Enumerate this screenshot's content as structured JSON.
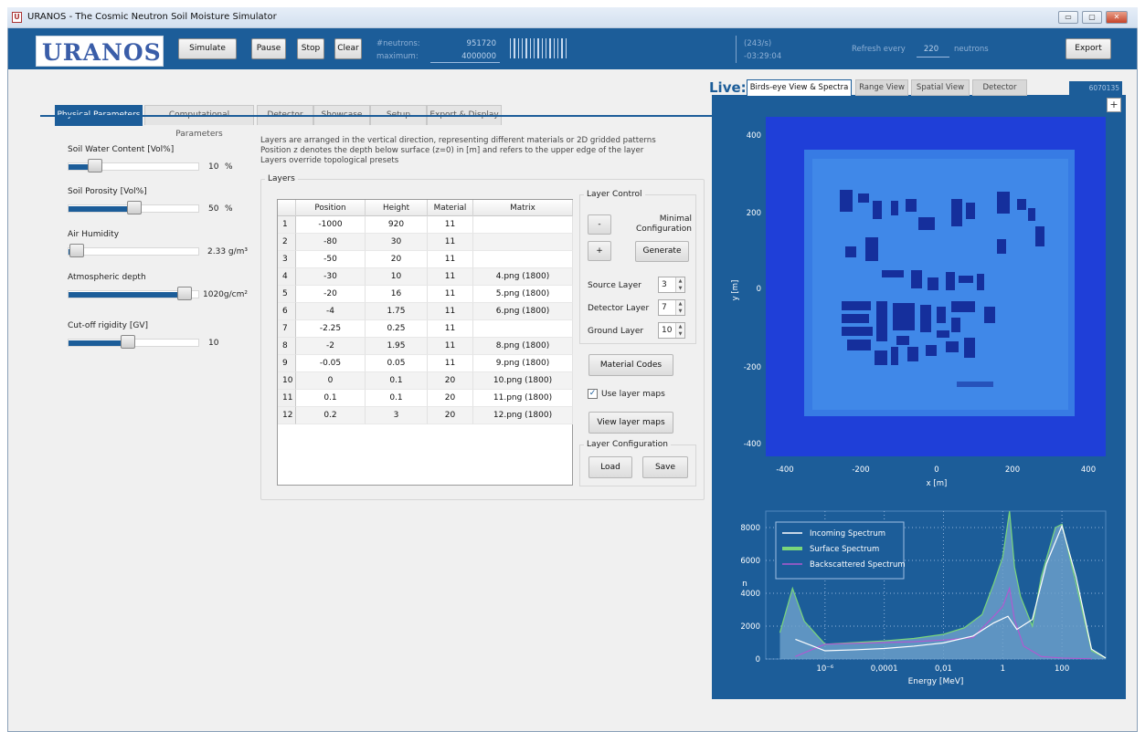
{
  "window": {
    "title": "URANOS - The Cosmic Neutron Soil Moisture Simulator",
    "icon": "uranos-icon",
    "min": "▭",
    "max": "▢",
    "close": "✕"
  },
  "toolbar": {
    "logo": "URANOS",
    "simulate": "Simulate",
    "pause": "Pause",
    "stop": "Stop",
    "clear": "Clear",
    "neutrons_label": "#neutrons:",
    "neutrons_value": "951720",
    "maximum_label": "maximum:",
    "maximum_value": "4000000",
    "rate": "(243/s)",
    "remaining": "-03:29:04",
    "refresh_label": "Refresh every",
    "refresh_value": "220",
    "refresh_unit": "neutrons",
    "export": "Export"
  },
  "tabs": [
    "Physical Parameters",
    "Computational Parameters",
    "Detector",
    "Showcase",
    "Setup",
    "Export & Display"
  ],
  "active_tab": 0,
  "params": [
    {
      "label": "Soil Water Content [Vol%]",
      "value": "10",
      "unit": "%",
      "level": 0.2
    },
    {
      "label": "Soil Porosity [Vol%]",
      "value": "50",
      "unit": "%",
      "level": 0.5
    },
    {
      "label": "Air Humidity",
      "value": "2.33 g/m³",
      "unit": "",
      "level": 0.06
    },
    {
      "label": "Atmospheric depth",
      "value": "1020g/cm²",
      "unit": "",
      "level": 0.88
    },
    {
      "label": "Cut-off rigidity [GV]",
      "value": "10",
      "unit": "",
      "level": 0.45
    }
  ],
  "info": [
    "Layers are arranged in the vertical direction, representing different materials or 2D gridded patterns",
    "Position z denotes the depth below surface (z=0) in [m] and refers to the upper edge of the layer",
    "Layers override topological presets"
  ],
  "layers": {
    "title": "Layers",
    "columns": [
      "Position",
      "Height",
      "Material",
      "Matrix"
    ],
    "rows": [
      [
        "1",
        "-1000",
        "920",
        "11",
        ""
      ],
      [
        "2",
        "-80",
        "30",
        "11",
        ""
      ],
      [
        "3",
        "-50",
        "20",
        "11",
        ""
      ],
      [
        "4",
        "-30",
        "10",
        "11",
        "4.png (1800)"
      ],
      [
        "5",
        "-20",
        "16",
        "11",
        "5.png (1800)"
      ],
      [
        "6",
        "-4",
        "1.75",
        "11",
        "6.png (1800)"
      ],
      [
        "7",
        "-2.25",
        "0.25",
        "11",
        ""
      ],
      [
        "8",
        "-2",
        "1.95",
        "11",
        "8.png (1800)"
      ],
      [
        "9",
        "-0.05",
        "0.05",
        "11",
        "9.png (1800)"
      ],
      [
        "10",
        "0",
        "0.1",
        "20",
        "10.png (1800)"
      ],
      [
        "11",
        "0.1",
        "0.1",
        "20",
        "11.png (1800)"
      ],
      [
        "12",
        "0.2",
        "3",
        "20",
        "12.png (1800)"
      ]
    ]
  },
  "control": {
    "title": "Layer Control",
    "minus": "-",
    "plus": "+",
    "minimal_line1": "Minimal",
    "minimal_line2": "Configuration",
    "generate": "Generate",
    "source_label": "Source Layer",
    "source_value": "3",
    "detector_label": "Detector Layer",
    "detector_value": "7",
    "ground_label": "Ground Layer",
    "ground_value": "10",
    "material_codes": "Material Codes",
    "use_maps": "Use layer maps",
    "use_maps_checked": true,
    "view_maps": "View layer maps",
    "config_title": "Layer Configuration",
    "load": "Load",
    "save": "Save"
  },
  "live": {
    "label": "Live:",
    "tabs": [
      "Birds-eye View & Spectra",
      "Range View",
      "Spatial View",
      "Detector"
    ],
    "active_tab": 0,
    "counter": "6070135",
    "plus": "+"
  },
  "map": {
    "x_label": "x [m]",
    "y_label": "y [m]",
    "x_ticks": [
      "-400",
      "-200",
      "0",
      "200",
      "400"
    ],
    "y_ticks": [
      "400",
      "200",
      "0",
      "-200",
      "-400"
    ],
    "colors": {
      "background": "#1f3fd8",
      "field": "#3c86e6",
      "buildings": "#152f9c"
    }
  },
  "chart_data": {
    "type": "line",
    "xlabel": "Energy [MeV]",
    "ylabel": "n",
    "x_scale": "log",
    "x_ticks": [
      "10⁻⁶",
      "0,0001",
      "0,01",
      "1",
      "100"
    ],
    "y_ticks": [
      "8000",
      "6000",
      "4000",
      "2000",
      "0"
    ],
    "ylim": [
      0,
      9000
    ],
    "legend_position": "top-left",
    "series": [
      {
        "name": "Incoming Spectrum",
        "color": "#ffffff",
        "points": [
          [
            1e-07,
            1200
          ],
          [
            1e-06,
            500
          ],
          [
            1e-05,
            560
          ],
          [
            0.0001,
            640
          ],
          [
            0.001,
            780
          ],
          [
            0.01,
            980
          ],
          [
            0.1,
            1400
          ],
          [
            0.5,
            2200
          ],
          [
            1.5,
            2600
          ],
          [
            3,
            1800
          ],
          [
            10,
            2400
          ],
          [
            30,
            5800
          ],
          [
            100,
            8100
          ],
          [
            300,
            5000
          ],
          [
            1000,
            600
          ],
          [
            3000,
            60
          ]
        ]
      },
      {
        "name": "Surface Spectrum",
        "color": "#7ad67a",
        "points": [
          [
            3e-08,
            1600
          ],
          [
            8e-08,
            4300
          ],
          [
            2e-07,
            2300
          ],
          [
            1e-06,
            900
          ],
          [
            1e-05,
            1000
          ],
          [
            0.0001,
            1100
          ],
          [
            0.001,
            1250
          ],
          [
            0.01,
            1500
          ],
          [
            0.05,
            1900
          ],
          [
            0.2,
            2700
          ],
          [
            0.5,
            4600
          ],
          [
            1,
            6200
          ],
          [
            1.7,
            9000
          ],
          [
            2.5,
            5600
          ],
          [
            4,
            3800
          ],
          [
            10,
            2000
          ],
          [
            20,
            5000
          ],
          [
            60,
            8000
          ],
          [
            100,
            8200
          ],
          [
            300,
            4600
          ],
          [
            1000,
            500
          ],
          [
            3000,
            60
          ]
        ]
      },
      {
        "name": "Backscattered Spectrum",
        "color": "#b05ad0",
        "points": [
          [
            1e-07,
            150
          ],
          [
            1e-06,
            900
          ],
          [
            1e-05,
            950
          ],
          [
            0.0001,
            1000
          ],
          [
            0.001,
            1050
          ],
          [
            0.01,
            1150
          ],
          [
            0.1,
            1300
          ],
          [
            0.5,
            2600
          ],
          [
            1,
            3200
          ],
          [
            1.7,
            4300
          ],
          [
            2.5,
            2400
          ],
          [
            5,
            800
          ],
          [
            20,
            150
          ],
          [
            100,
            60
          ],
          [
            1000,
            10
          ]
        ]
      }
    ]
  }
}
